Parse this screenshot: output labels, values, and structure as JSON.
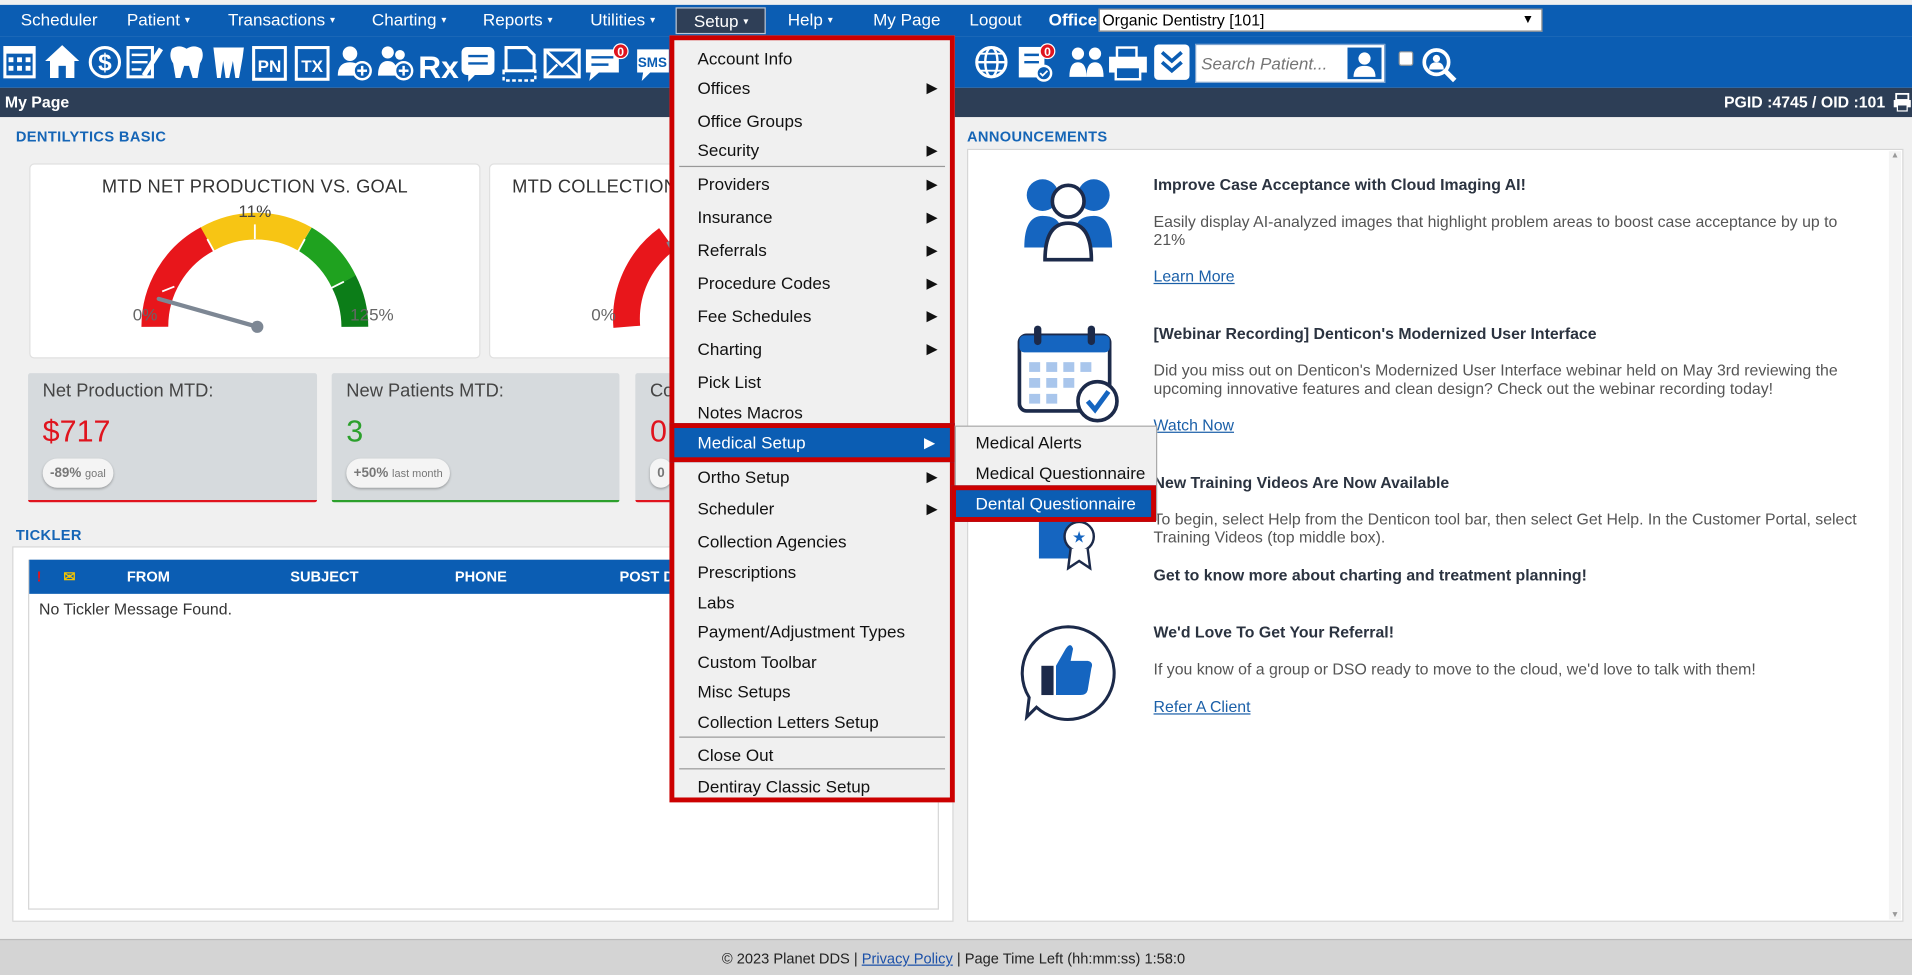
{
  "topnav": {
    "items": [
      {
        "label": "Scheduler"
      },
      {
        "label": "Patient",
        "caret": "▾"
      },
      {
        "label": "Transactions",
        "caret": "▾"
      },
      {
        "label": "Charting",
        "caret": "▾"
      },
      {
        "label": "Reports",
        "caret": "▾"
      },
      {
        "label": "Utilities",
        "caret": "▾"
      },
      {
        "label": "Setup",
        "caret": "▾"
      },
      {
        "label": "Help",
        "caret": "▾"
      },
      {
        "label": "My Page"
      },
      {
        "label": "Logout"
      }
    ],
    "office_label": "Office",
    "office_value": "Organic Dentistry [101]"
  },
  "toolbar": {
    "search_placeholder": "Search Patient...",
    "badge_count": "0",
    "pn_label": "PN",
    "tx_label": "TX",
    "rx_label": "Rx",
    "sms_label": "SMS"
  },
  "pagebar": {
    "title": "My Page",
    "ids": "PGID :4745  /  OID :101"
  },
  "dentilytics": {
    "section_label": "DENTILYTICS BASIC",
    "gauge1": {
      "title": "MTD NET PRODUCTION VS. GOAL",
      "value_label": "11%",
      "min_label": "0%",
      "max_label": "125%",
      "value": 0.088
    },
    "gauge2": {
      "title": "MTD COLLECTION",
      "min_label": "0%"
    },
    "stats": [
      {
        "title": "Net Production MTD:",
        "value": "$717",
        "pill_value": "-89%",
        "pill_suffix": "goal"
      },
      {
        "title": "New Patients MTD:",
        "value": "3",
        "pill_value": "+50%",
        "pill_suffix": "last month"
      },
      {
        "title": "Co",
        "pill_value": "0"
      }
    ]
  },
  "tickler": {
    "section_label": "TICKLER",
    "columns": [
      "FROM",
      "SUBJECT",
      "PHONE",
      "POST D"
    ],
    "empty_text": "No Tickler Message Found."
  },
  "announcements": {
    "section_label": "ANNOUNCEMENTS",
    "items": [
      {
        "title": "Improve Case Acceptance with Cloud Imaging AI!",
        "body": "Easily display AI-analyzed images that highlight problem areas to boost case acceptance by up to 21%",
        "link": "Learn More"
      },
      {
        "title": "[Webinar Recording] Denticon's Modernized User Interface",
        "body": "Did you miss out on Denticon's Modernized User Interface webinar held on May 3rd reviewing the upcoming innovative features and clean design? Check out the webinar recording today!",
        "link": "Watch Now"
      },
      {
        "title": "New Training Videos Are Now Available",
        "body": "To begin, select Help from the Denticon tool bar, then select Get Help. In the Customer Portal, select Training Videos (top middle box).",
        "extra": "Get to know more about charting and treatment planning!"
      },
      {
        "title": "We'd Love To Get Your Referral!",
        "body": "If you know of a group or DSO ready to move to the cloud, we'd love to talk with them!",
        "link": "Refer A Client"
      }
    ]
  },
  "setup_menu": {
    "items": [
      {
        "label": "Account Info"
      },
      {
        "label": "Offices",
        "arrow": "▶"
      },
      {
        "label": "Office Groups"
      },
      {
        "label": "Security",
        "arrow": "▶"
      },
      {
        "label": "Providers",
        "arrow": "▶"
      },
      {
        "label": "Insurance",
        "arrow": "▶"
      },
      {
        "label": "Referrals",
        "arrow": "▶"
      },
      {
        "label": "Procedure Codes",
        "arrow": "▶"
      },
      {
        "label": "Fee Schedules",
        "arrow": "▶"
      },
      {
        "label": "Charting",
        "arrow": "▶"
      },
      {
        "label": "Pick List"
      },
      {
        "label": "Notes Macros"
      },
      {
        "label": "Medical Setup",
        "arrow": "▶"
      },
      {
        "label": "Ortho Setup",
        "arrow": "▶"
      },
      {
        "label": "Scheduler",
        "arrow": "▶"
      },
      {
        "label": "Collection Agencies"
      },
      {
        "label": "Prescriptions"
      },
      {
        "label": "Labs"
      },
      {
        "label": "Payment/Adjustment Types"
      },
      {
        "label": "Custom Toolbar"
      },
      {
        "label": "Misc Setups"
      },
      {
        "label": "Collection Letters Setup"
      },
      {
        "label": "Close Out"
      },
      {
        "label": "Dentiray Classic Setup"
      }
    ]
  },
  "medical_submenu": {
    "items": [
      {
        "label": "Medical Alerts"
      },
      {
        "label": "Medical Questionnaire"
      },
      {
        "label": "Dental Questionnaire"
      }
    ]
  },
  "footer": {
    "copyright": "© 2023 Planet DDS | ",
    "privacy": "Privacy Policy",
    "time_left": " |  Page Time Left (hh:mm:ss) 1:58:0"
  },
  "colors": {
    "nav_blue": "#0b5db3",
    "highlight_red": "#cc0000",
    "value_red": "#e0141e",
    "value_green": "#2ca02c"
  }
}
